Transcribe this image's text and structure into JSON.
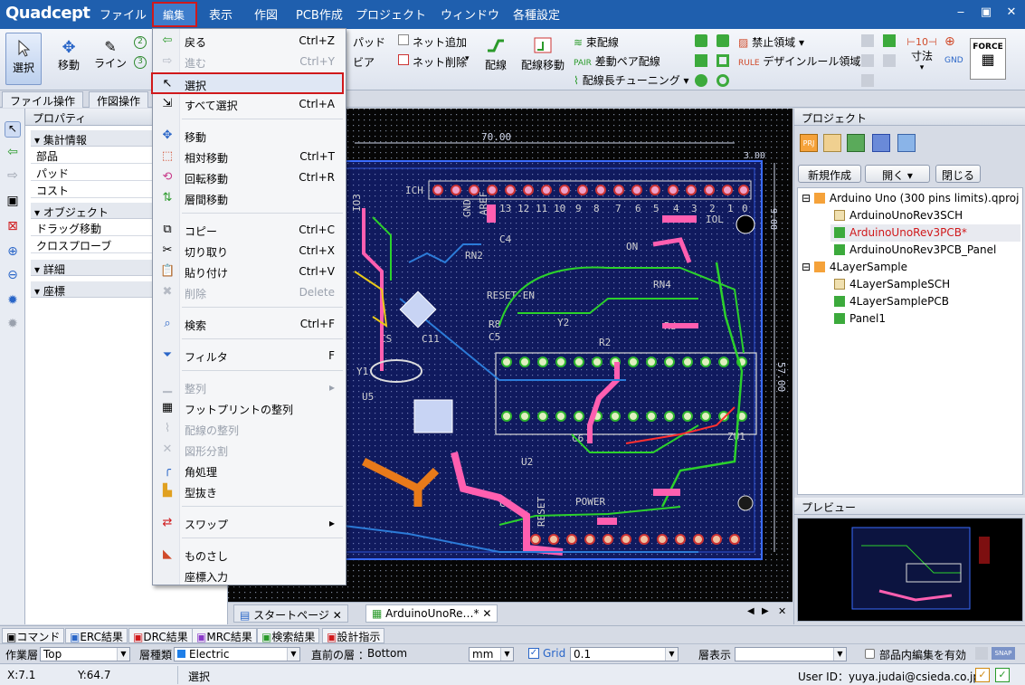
{
  "app": {
    "logo": "Quadcept"
  },
  "menubar": {
    "items": [
      "ファイル",
      "編集",
      "表示",
      "作図",
      "PCB作成",
      "プロジェクト",
      "ウィンドウ",
      "各種設定"
    ],
    "window_buttons": [
      "‒",
      "▣",
      "✕"
    ]
  },
  "ribbon": {
    "select": "選択",
    "move": "移動",
    "line": "ライン",
    "pad": "パッド",
    "via": "ビア",
    "net_add": "ネット追加",
    "net_delete": "ネット削除",
    "route": "配線",
    "route_move": "配線移動",
    "bundle_route": "束配線",
    "diff_pair": "差動ペア配線",
    "length_tuning": "配線長チューニング",
    "keepout": "禁止領域",
    "design_rule_area": "デザインルール領域",
    "dimension": "寸法",
    "force": "FORCE"
  },
  "ribbon_tabs": [
    "ファイル操作",
    "作図操作"
  ],
  "properties": {
    "title": "プロパティ",
    "sections": [
      {
        "label": "集計情報",
        "rows": [
          "部品",
          "パッド",
          "コスト"
        ]
      },
      {
        "label": "オブジェクト",
        "rows": [
          "ドラッグ移動",
          "クロスプローブ"
        ]
      },
      {
        "label": "詳細",
        "rows": []
      },
      {
        "label": "座標",
        "rows": []
      }
    ]
  },
  "edit_menu": {
    "items": [
      {
        "label": "戻る",
        "shortcut": "Ctrl+Z",
        "disabled": false,
        "icon": "undo-icon"
      },
      {
        "label": "進む",
        "shortcut": "Ctrl+Y",
        "disabled": true,
        "icon": "redo-icon"
      },
      {
        "label": "選択",
        "shortcut": "",
        "disabled": false,
        "icon": "cursor-icon"
      },
      {
        "label": "すべて選択",
        "shortcut": "Ctrl+A",
        "disabled": false,
        "icon": "select-all-icon"
      },
      {
        "label": "移動",
        "shortcut": "",
        "disabled": false,
        "icon": "move-icon"
      },
      {
        "label": "相対移動",
        "shortcut": "Ctrl+T",
        "disabled": false,
        "icon": "relative-move-icon"
      },
      {
        "label": "回転移動",
        "shortcut": "Ctrl+R",
        "disabled": false,
        "icon": "rotate-icon"
      },
      {
        "label": "層間移動",
        "shortcut": "",
        "disabled": false,
        "icon": "layer-move-icon"
      },
      {
        "label": "コピー",
        "shortcut": "Ctrl+C",
        "disabled": false,
        "icon": "copy-icon"
      },
      {
        "label": "切り取り",
        "shortcut": "Ctrl+X",
        "disabled": false,
        "icon": "cut-icon"
      },
      {
        "label": "貼り付け",
        "shortcut": "Ctrl+V",
        "disabled": false,
        "icon": "paste-icon"
      },
      {
        "label": "削除",
        "shortcut": "Delete",
        "disabled": true,
        "icon": "delete-icon"
      },
      {
        "label": "検索",
        "shortcut": "Ctrl+F",
        "disabled": false,
        "icon": "search-icon"
      },
      {
        "label": "フィルタ",
        "shortcut": "F",
        "disabled": false,
        "icon": "filter-icon"
      },
      {
        "label": "整列",
        "shortcut": "",
        "disabled": true,
        "icon": "align-icon"
      },
      {
        "label": "フットプリントの整列",
        "shortcut": "",
        "disabled": false,
        "icon": "footprint-align-icon"
      },
      {
        "label": "配線の整列",
        "shortcut": "",
        "disabled": true,
        "icon": "route-align-icon"
      },
      {
        "label": "図形分割",
        "shortcut": "",
        "disabled": true,
        "icon": "split-icon"
      },
      {
        "label": "角処理",
        "shortcut": "",
        "disabled": false,
        "icon": "corner-icon"
      },
      {
        "label": "型抜き",
        "shortcut": "",
        "disabled": false,
        "icon": "cutout-icon"
      },
      {
        "label": "スワップ",
        "shortcut": "",
        "disabled": false,
        "icon": "swap-icon"
      },
      {
        "label": "ものさし",
        "shortcut": "",
        "disabled": false,
        "icon": "ruler-icon"
      },
      {
        "label": "座標入力",
        "shortcut": "",
        "disabled": false,
        "icon": "coordinate-icon"
      }
    ]
  },
  "canvas": {
    "dim_top": "70.00",
    "dim_right": "57.00",
    "dim_small": "3.00",
    "dim_small2": "9.00",
    "labels": [
      "ICH",
      "AREF",
      "GND",
      "13",
      "12",
      "11",
      "10",
      "9",
      "8",
      "7",
      "6",
      "5",
      "4",
      "3",
      "2",
      "1",
      "0",
      "IOL",
      "ON",
      "RN2",
      "RN4",
      "RESET-EN",
      "RESET",
      "C4",
      "C5",
      "C6",
      "R8",
      "Y1",
      "Y2",
      "U5",
      "C3",
      "U2",
      "ZU1",
      "POWER",
      "Rd",
      "R2",
      "C11",
      "CS",
      "IO3"
    ]
  },
  "doc_tabs": [
    "スタートページ",
    "ArduinoUnoRe…*"
  ],
  "project_panel": {
    "title": "プロジェクト",
    "buttons": [
      "新規作成",
      "開く",
      "閉じる"
    ],
    "tree": [
      {
        "label": "Arduino Uno (300 pins limits).qproj",
        "level": 0,
        "type": "project",
        "active": false
      },
      {
        "label": "ArduinoUnoRev3SCH",
        "level": 1,
        "type": "sch",
        "active": false
      },
      {
        "label": "ArduinoUnoRev3PCB*",
        "level": 1,
        "type": "pcb",
        "active": true
      },
      {
        "label": "ArduinoUnoRev3PCB_Panel",
        "level": 1,
        "type": "panel",
        "active": false
      },
      {
        "label": "4LayerSample",
        "level": 0,
        "type": "project",
        "active": false
      },
      {
        "label": "4LayerSampleSCH",
        "level": 1,
        "type": "sch",
        "active": false
      },
      {
        "label": "4LayerSamplePCB",
        "level": 1,
        "type": "pcb",
        "active": false
      },
      {
        "label": "Panel1",
        "level": 1,
        "type": "panel",
        "active": false
      }
    ],
    "preview_title": "プレビュー"
  },
  "bottom_tabs": [
    "コマンド",
    "ERC結果",
    "DRC結果",
    "MRC結果",
    "検索結果",
    "設計指示"
  ],
  "layer_bar": {
    "work_layer_label": "作業層",
    "work_layer": "Top",
    "layer_type_label": "層種類",
    "layer_type": "Electric",
    "prev_layer_label": "直前の層 ：",
    "prev_layer": "Bottom",
    "unit": "mm",
    "grid_label": "Grid",
    "grid_value": "0.1",
    "layer_display_label": "層表示",
    "layer_display": "",
    "in_part_edit_label": "部品内編集を有効"
  },
  "status": {
    "x": "X:7.1",
    "y": "Y:64.7",
    "mode": "選択",
    "user": "User ID：yuya.judai@csieda.co.jp"
  },
  "colors": {
    "menubar": "#1f5fae",
    "highlight": "#d0191b",
    "pcb_trace_blue": "#1c4dd8",
    "pcb_trace_pink": "#ff5fb0",
    "pcb_trace_green": "#2cd12c",
    "pcb_trace_orange": "#e87a1a"
  }
}
